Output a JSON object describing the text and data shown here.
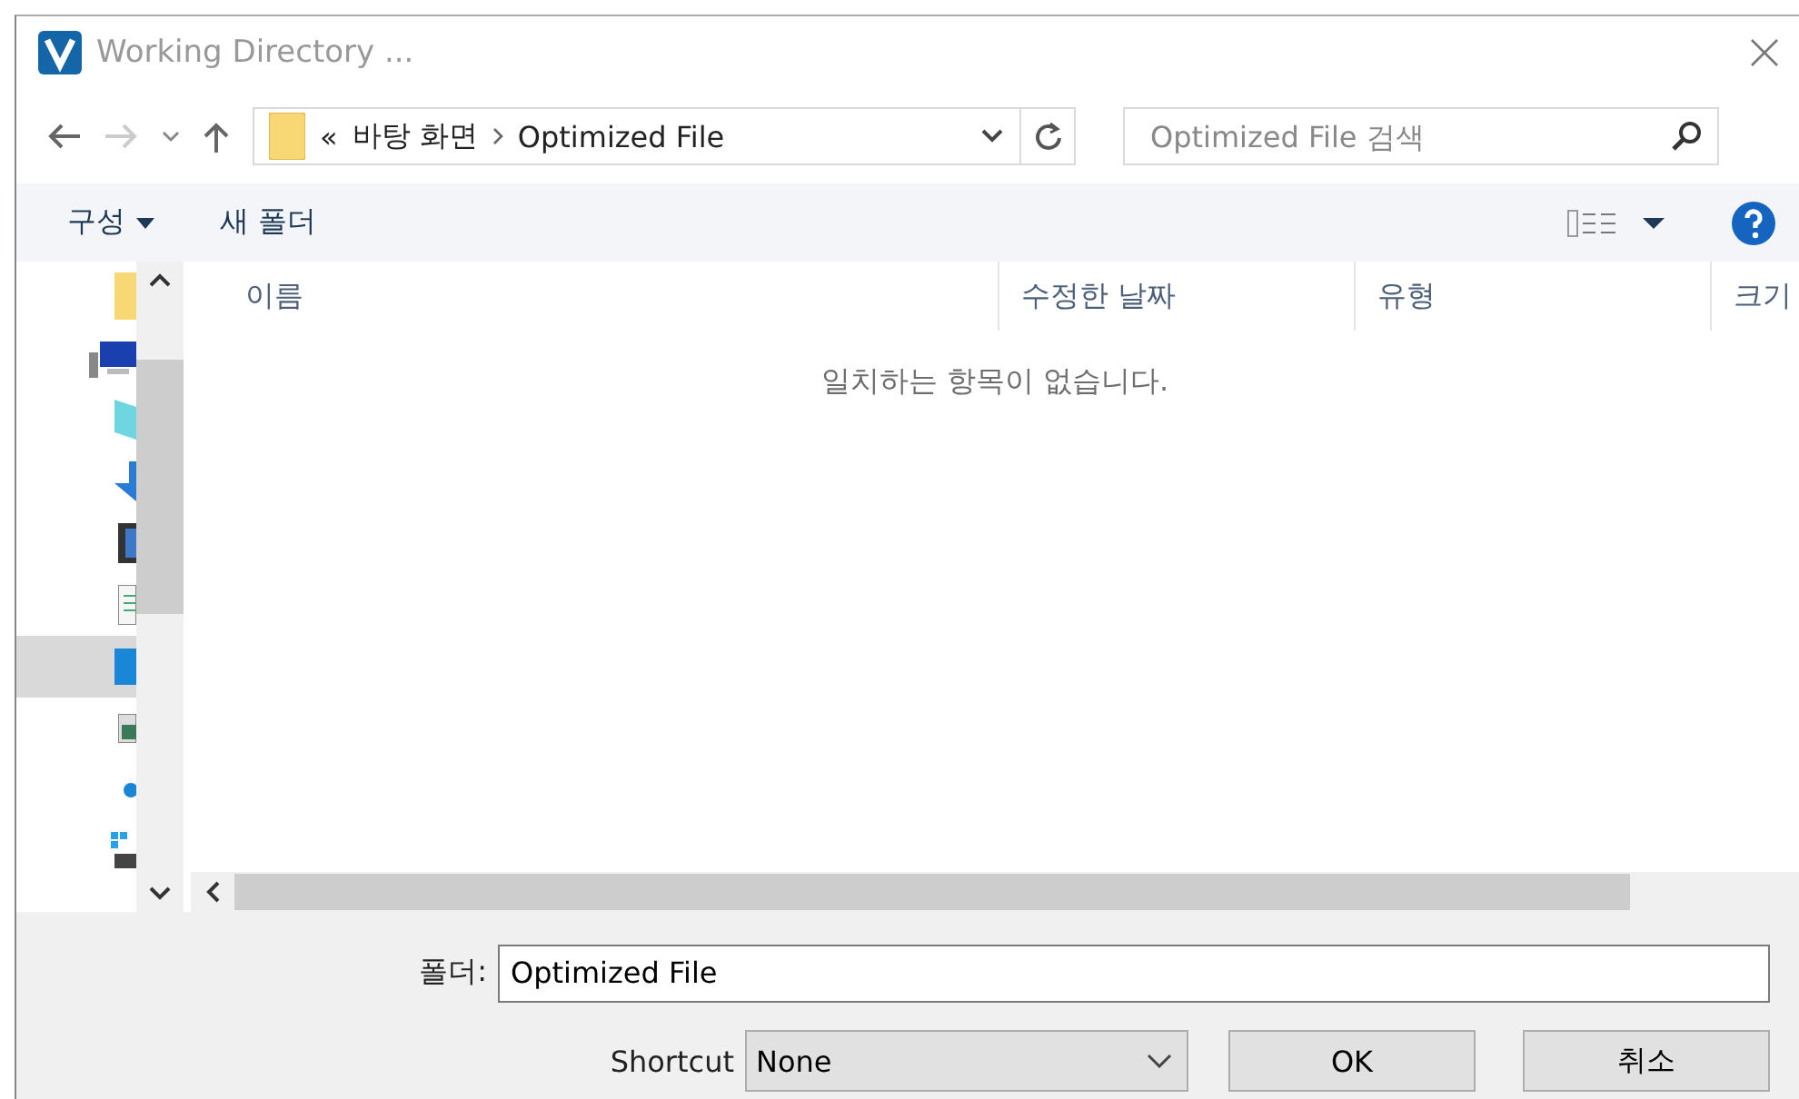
{
  "window": {
    "title": "Working Directory ..."
  },
  "breadcrumb": {
    "overflow": "«",
    "items": [
      "바탕 화면",
      "Optimized File"
    ]
  },
  "search": {
    "placeholder": "Optimized File 검색"
  },
  "toolbar": {
    "organize": "구성",
    "new_folder": "새 폴더"
  },
  "sidebar": {
    "items": [
      {
        "kind": "folder",
        "selected": false
      },
      {
        "kind": "computer",
        "selected": false
      },
      {
        "kind": "cube",
        "selected": false
      },
      {
        "kind": "download",
        "selected": false
      },
      {
        "kind": "video",
        "selected": false
      },
      {
        "kind": "document",
        "selected": false
      },
      {
        "kind": "desktop",
        "selected": true
      },
      {
        "kind": "image",
        "selected": false
      },
      {
        "kind": "cloud",
        "selected": false
      },
      {
        "kind": "drive",
        "selected": false
      }
    ]
  },
  "table": {
    "columns": [
      "이름",
      "수정한 날짜",
      "유형",
      "크기"
    ],
    "empty_message": "일치하는 항목이 없습니다."
  },
  "footer": {
    "folder_label": "폴더:",
    "folder_value": "Optimized File",
    "shortcut_label": "Shortcut",
    "shortcut_value": "None",
    "buttons": [
      "OK",
      "취소"
    ]
  }
}
